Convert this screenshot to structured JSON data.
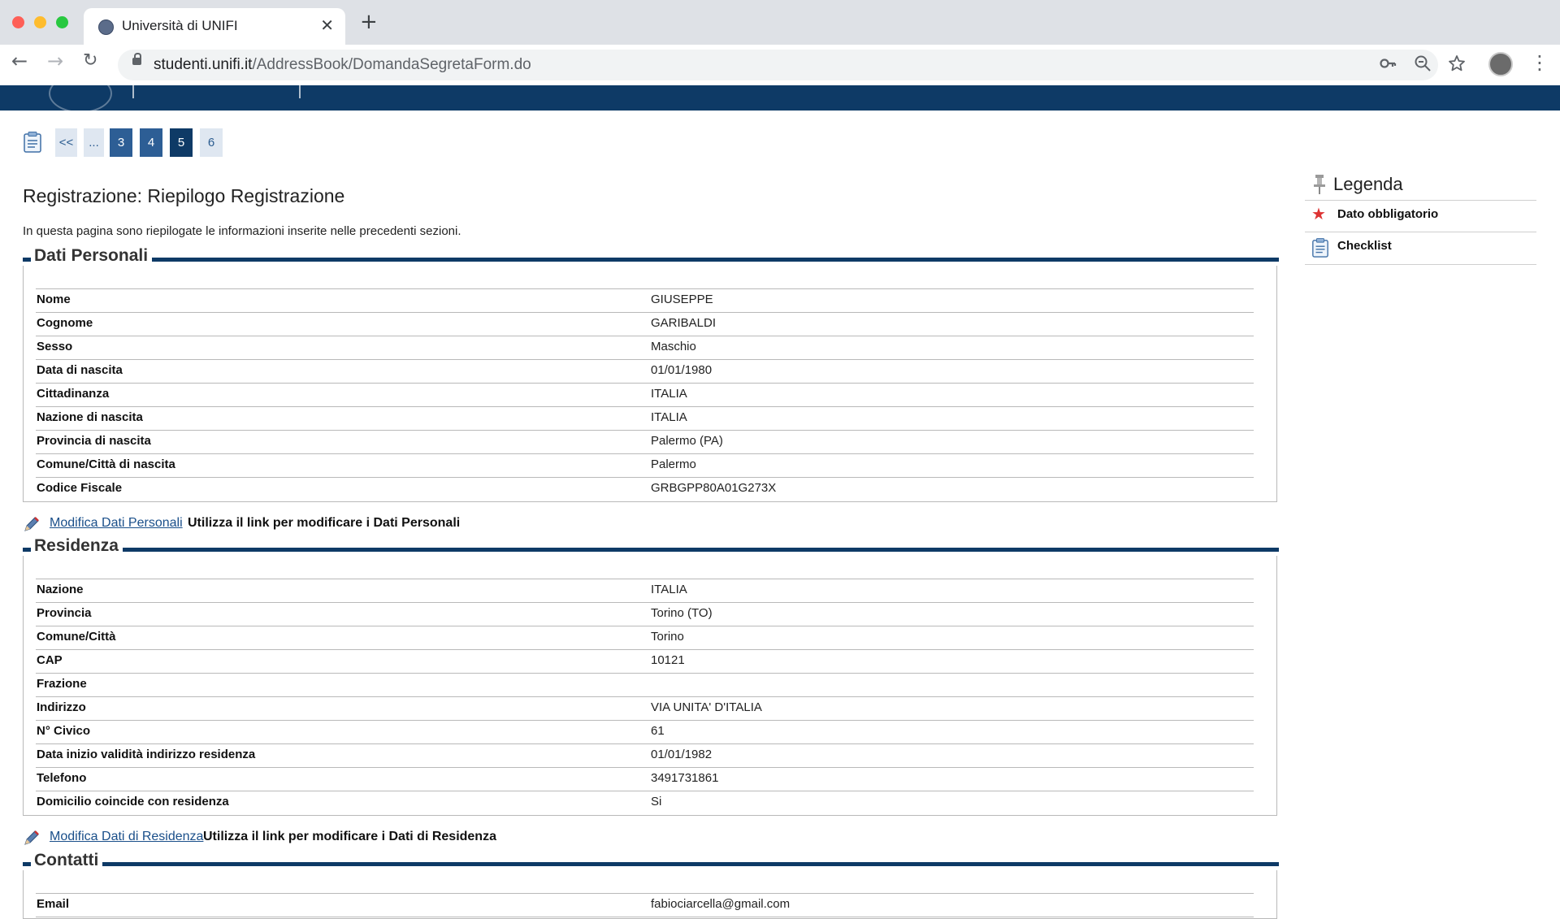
{
  "browser": {
    "tab_title": "Università di UNIFI",
    "url_host": "studenti.unifi.it",
    "url_path": "/AddressBook/DomandaSegretaForm.do"
  },
  "steps": {
    "items": [
      "<<",
      "...",
      "3",
      "4",
      "5",
      "6"
    ],
    "current": "5"
  },
  "page": {
    "title": "Registrazione: Riepilogo Registrazione",
    "intro": "In questa pagina sono riepilogate le informazioni inserite nelle precedenti sezioni."
  },
  "dati_personali": {
    "legend": "Dati Personali",
    "rows": [
      {
        "label": "Nome",
        "value": "GIUSEPPE"
      },
      {
        "label": "Cognome",
        "value": "GARIBALDI"
      },
      {
        "label": "Sesso",
        "value": "Maschio"
      },
      {
        "label": "Data di nascita",
        "value": "01/01/1980"
      },
      {
        "label": "Cittadinanza",
        "value": "ITALIA"
      },
      {
        "label": "Nazione di nascita",
        "value": "ITALIA"
      },
      {
        "label": "Provincia di nascita",
        "value": "Palermo (PA)"
      },
      {
        "label": "Comune/Città di nascita",
        "value": "Palermo"
      },
      {
        "label": "Codice Fiscale",
        "value": "GRBGPP80A01G273X"
      }
    ],
    "edit_link": "Modifica Dati Personali",
    "edit_desc": "Utilizza il link per modificare i Dati Personali"
  },
  "residenza": {
    "legend": "Residenza",
    "rows": [
      {
        "label": "Nazione",
        "value": "ITALIA"
      },
      {
        "label": "Provincia",
        "value": "Torino (TO)"
      },
      {
        "label": "Comune/Città",
        "value": "Torino"
      },
      {
        "label": "CAP",
        "value": "10121"
      },
      {
        "label": "Frazione",
        "value": ""
      },
      {
        "label": "Indirizzo",
        "value": "VIA UNITA' D'ITALIA"
      },
      {
        "label": "N° Civico",
        "value": "61"
      },
      {
        "label": "Data inizio validità indirizzo residenza",
        "value": "01/01/1982"
      },
      {
        "label": "Telefono",
        "value": "3491731861"
      },
      {
        "label": "Domicilio coincide con residenza",
        "value": "Si"
      }
    ],
    "edit_link": "Modifica Dati di Residenza",
    "edit_desc": "Utilizza il link per modificare i Dati di Residenza"
  },
  "contatti": {
    "legend": "Contatti",
    "rows": [
      {
        "label": "Email",
        "value": "fabiociarcella@gmail.com"
      }
    ]
  },
  "legenda": {
    "title": "Legenda",
    "items": [
      {
        "icon": "required-star-icon",
        "label": "Dato obbligatorio"
      },
      {
        "icon": "checklist-icon",
        "label": "Checklist"
      }
    ]
  },
  "colors": {
    "brand": "#0e3a66",
    "step_light": "#dfe7f1",
    "step_dark": "#2d5e95",
    "link": "#1a4f8a",
    "required": "#dd3333"
  }
}
